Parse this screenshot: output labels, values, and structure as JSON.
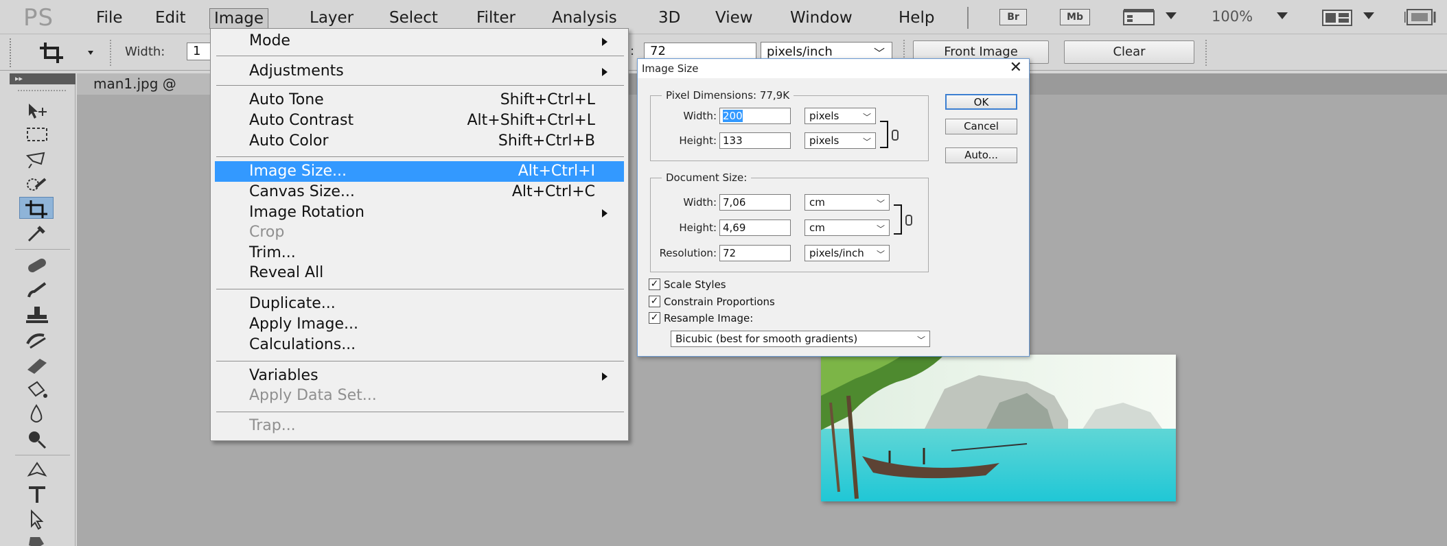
{
  "app": {
    "logo": "PS"
  },
  "menubar": {
    "items": [
      "File",
      "Edit",
      "Image",
      "Layer",
      "Select",
      "Filter",
      "Analysis",
      "3D",
      "View",
      "Window",
      "Help"
    ],
    "bridge_button": "Br",
    "minibridge_button": "Mb",
    "zoom": "100%"
  },
  "options": {
    "width_label": "Width:",
    "width_value": "1",
    "resolution_label": ":",
    "resolution_value": "72",
    "resolution_unit": "pixels/inch",
    "front_image_button": "Front Image",
    "clear_button": "Clear"
  },
  "document": {
    "tab_title": "man1.jpg @"
  },
  "image_menu": {
    "mode": "Mode",
    "adjustments": "Adjustments",
    "auto_tone": "Auto Tone",
    "auto_tone_sc": "Shift+Ctrl+L",
    "auto_contrast": "Auto Contrast",
    "auto_contrast_sc": "Alt+Shift+Ctrl+L",
    "auto_color": "Auto Color",
    "auto_color_sc": "Shift+Ctrl+B",
    "image_size": "Image Size...",
    "image_size_sc": "Alt+Ctrl+I",
    "canvas_size": "Canvas Size...",
    "canvas_size_sc": "Alt+Ctrl+C",
    "image_rotation": "Image Rotation",
    "crop": "Crop",
    "trim": "Trim...",
    "reveal_all": "Reveal All",
    "duplicate": "Duplicate...",
    "apply_image": "Apply Image...",
    "calculations": "Calculations...",
    "variables": "Variables",
    "apply_data_set": "Apply Data Set...",
    "trap": "Trap..."
  },
  "dialog": {
    "title": "Image Size",
    "close": "✕",
    "pixel_dimensions": "Pixel Dimensions:  77,9K",
    "width_label": "Width:",
    "height_label": "Height:",
    "px_width": "200",
    "px_height": "133",
    "px_unit": "pixels",
    "document_size": "Document Size:",
    "doc_width": "7,06",
    "doc_height": "4,69",
    "doc_unit": "cm",
    "resolution_label": "Resolution:",
    "resolution": "72",
    "resolution_unit": "pixels/inch",
    "ok": "OK",
    "cancel": "Cancel",
    "auto": "Auto...",
    "scale_styles": "Scale Styles",
    "constrain_proportions": "Constrain Proportions",
    "resample_image": "Resample Image:",
    "resample_method": "Bicubic (best for smooth gradients)",
    "check_mark": "✓"
  }
}
